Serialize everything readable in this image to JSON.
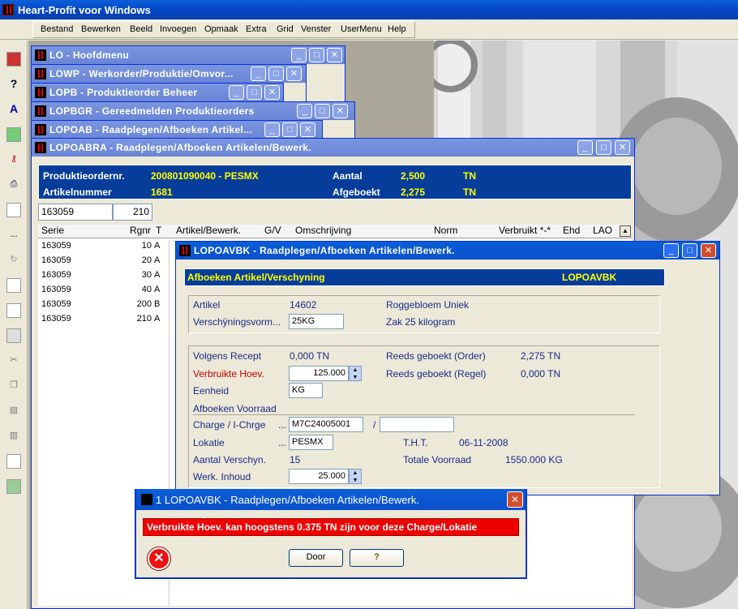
{
  "app": {
    "title": "Heart-Profit voor Windows"
  },
  "menu": [
    "Bestand",
    "Bewerken",
    "Beeld",
    "Invoegen",
    "Opmaak",
    "Extra",
    "Grid",
    "Venster",
    "UserMenu",
    "Help"
  ],
  "windows": {
    "w1": "LO - Hoofdmenu",
    "w2": "LOWP - Werkorder/Produktie/Omvor...",
    "w3": "LOPB - Produktieorder Beheer",
    "w4": "LOPBGR - Gereedmelden Produktieorders",
    "w5": "LOPOAB - Raadplegen/Afboeken Artikel...",
    "w6": "LOPOABRA - Raadplegen/Afboeken Artikelen/Bewerk."
  },
  "lopoabra": {
    "prod_label": "Produktieordernr.",
    "prod_value": "200801090040 - PESMX",
    "art_label": "Artikelnummer",
    "art_value": "1681",
    "aantal_label": "Aantal",
    "aantal_value": "2,500",
    "aantal_unit": "TN",
    "afgeboekt_label": "Afgeboekt",
    "afgeboekt_value": "2,275",
    "afgeboekt_unit": "TN",
    "filter_serie": "163059",
    "filter_rgnr": "210",
    "columns": [
      "Serie",
      "Rgnr",
      "T",
      "Artikel/Bewerk.",
      "G/V",
      "Omschrijving",
      "Norm",
      "Verbruikt *-*",
      "Ehd",
      "LAO"
    ],
    "rows": [
      {
        "serie": "163059",
        "rgnr": "10",
        "t": "A"
      },
      {
        "serie": "163059",
        "rgnr": "20",
        "t": "A"
      },
      {
        "serie": "163059",
        "rgnr": "30",
        "t": "A"
      },
      {
        "serie": "163059",
        "rgnr": "40",
        "t": "A"
      },
      {
        "serie": "163059",
        "rgnr": "200",
        "t": "B"
      },
      {
        "serie": "163059",
        "rgnr": "210",
        "t": "A"
      }
    ]
  },
  "lopoavbk": {
    "title": "LOPOAVBK - Raadplegen/Afboeken Artikelen/Bewerk.",
    "header_left": "Afboeken Artikel/Verschyning",
    "header_right": "LOPOAVBK",
    "artikel_label": "Artikel",
    "artikel_value": "14602",
    "artikel_desc": "Roggebloem Uniek",
    "vv_label": "Verschÿningsvorm...",
    "vv_value": "25KG",
    "vv_desc": "Zak 25 kilogram",
    "recept_label": "Volgens Recept",
    "recept_value": "0,000 TN",
    "order_label": "Reeds geboekt (Order)",
    "order_value": "2,275 TN",
    "verbr_label": "Verbruikte Hoev.",
    "verbr_value": "125.000",
    "regel_label": "Reeds geboekt (Regel)",
    "regel_value": "0,000 TN",
    "eenheid_label": "Eenheid",
    "eenheid_value": "KG",
    "voorraad_label": "Afboeken Voorraad",
    "charge_label": "Charge / I-Chrge",
    "charge_dots": "...",
    "charge_value": "M7C24005001",
    "charge_slash": "/",
    "charge_value2": "",
    "lok_label": "Lokatie",
    "lok_dots": "...",
    "lok_value": "PESMX",
    "tht_label": "T.H.T.",
    "tht_value": "06-11-2008",
    "aantal_v_label": "Aantal Verschyn.",
    "aantal_v_value": "15",
    "totvr_label": "Totale Voorraad",
    "totvr_value": "1550.000 KG",
    "inhoud_label": "Werk. Inhoud",
    "inhoud_value": "25.000"
  },
  "dialog": {
    "title": "1 LOPOAVBK - Raadplegen/Afboeken Artikelen/Bewerk.",
    "message": "Verbruikte Hoev. kan hoogstens 0.375 TN zijn voor deze Charge/Lokatie",
    "ok_label": "Door",
    "help_label": "?"
  },
  "colors": {
    "header_blue": "#063d9b",
    "yellow": "#ffff00",
    "error_red": "#ee0000"
  }
}
